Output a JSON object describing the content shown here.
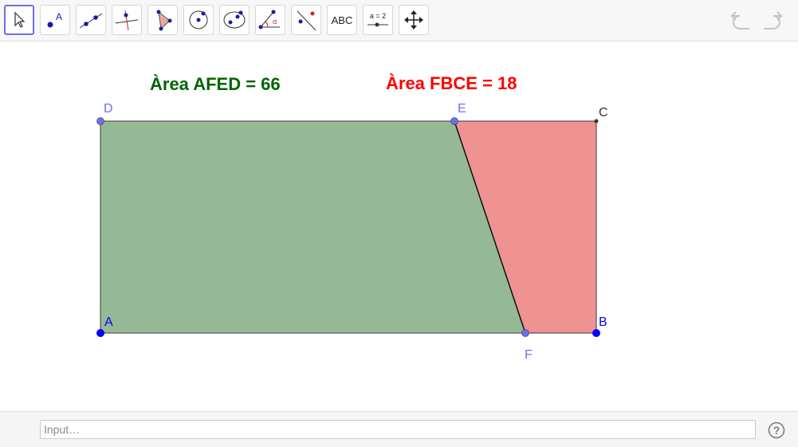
{
  "toolbar": {
    "tools": [
      {
        "name": "move-tool",
        "icon": "move-arrow-icon"
      },
      {
        "name": "point-tool",
        "icon": "point-icon",
        "icon_text": "A"
      },
      {
        "name": "line-tool",
        "icon": "line-icon"
      },
      {
        "name": "perpendicular-line-tool",
        "icon": "perpendicular-line-icon"
      },
      {
        "name": "polygon-tool",
        "icon": "polygon-icon"
      },
      {
        "name": "circle-tool",
        "icon": "circle-icon"
      },
      {
        "name": "ellipse-tool",
        "icon": "ellipse-icon"
      },
      {
        "name": "angle-tool",
        "icon": "angle-icon",
        "icon_text": "α"
      },
      {
        "name": "reflect-tool",
        "icon": "reflect-icon"
      },
      {
        "name": "text-tool",
        "icon": "text-icon",
        "icon_text": "ABC"
      },
      {
        "name": "slider-tool",
        "icon": "slider-icon",
        "icon_text": "a = 2"
      },
      {
        "name": "move-graphics-tool",
        "icon": "move-graphics-icon"
      }
    ],
    "undo_icon": "undo-icon",
    "redo_icon": "redo-icon"
  },
  "graphics": {
    "area_afed_text": "Àrea AFED = 66",
    "area_fbce_text": "Àrea FBCE = 18",
    "points": {
      "A": "A",
      "B": "B",
      "C": "C",
      "D": "D",
      "E": "E",
      "F": "F"
    },
    "colors": {
      "green_fill": "#96b995",
      "red_fill": "#ef9292",
      "green_text": "#006400",
      "red_text": "#ff0000",
      "point_dark_blue": "#0000ff",
      "point_light_blue": "#6e6ef0",
      "point_black": "#333333"
    }
  },
  "input_bar": {
    "placeholder": "Input…",
    "help_icon": "help-icon",
    "help_text": "?"
  }
}
